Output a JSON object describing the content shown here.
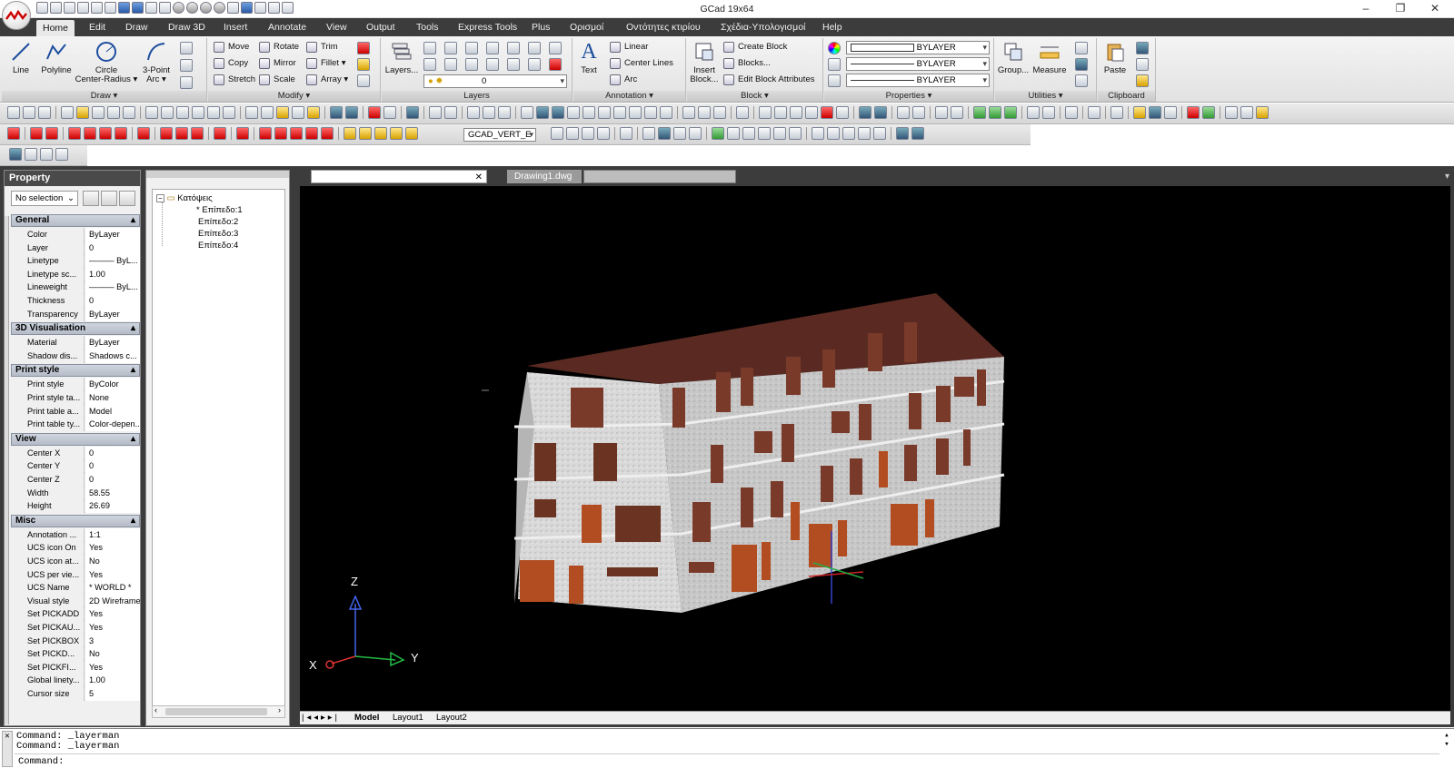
{
  "app": {
    "title": "GCad 19x64",
    "window_controls": [
      "minimize-icon",
      "restore-icon",
      "close-icon"
    ]
  },
  "menu": {
    "tabs": [
      "Home",
      "Edit",
      "Draw",
      "Draw 3D",
      "Insert",
      "Annotate",
      "View",
      "Output",
      "Tools",
      "Express Tools",
      "Plus",
      "Ορισμοί",
      "Οντότητες κτιρίου",
      "Σχέδια-Υπολογισμοί",
      "Help"
    ],
    "active": "Home"
  },
  "ribbon": {
    "draw": {
      "label": "Draw ▾",
      "line": "Line",
      "polyline": "Polyline",
      "circle1": "Circle",
      "circle2": "Center-Radius ▾",
      "arc1": "3-Point",
      "arc2": "Arc ▾"
    },
    "modify": {
      "label": "Modify ▾",
      "move": "Move",
      "rotate": "Rotate",
      "trim": "Trim",
      "copy": "Copy",
      "mirror": "Mirror",
      "fillet": "Fillet ▾",
      "stretch": "Stretch",
      "scale": "Scale",
      "array": "Array ▾"
    },
    "layers": {
      "label": "Layers",
      "button": "Layers...",
      "current_layer": "0"
    },
    "annotation": {
      "label": "Annotation ▾",
      "text": "Text",
      "linear": "Linear",
      "center_lines": "Center Lines",
      "arc": "Arc"
    },
    "block": {
      "label": "Block ▾",
      "insert1": "Insert",
      "insert2": "Block...",
      "create": "Create Block",
      "blocks": "Blocks...",
      "edit_attr": "Edit Block Attributes"
    },
    "properties": {
      "label": "Properties ▾",
      "color": "BYLAYER",
      "linetype": "BYLAYER",
      "lineweight": "BYLAYER"
    },
    "utilities": {
      "label": "Utilities ▾",
      "group": "Group...",
      "measure": "Measure"
    },
    "clipboard": {
      "label": "Clipboard",
      "paste": "Paste"
    }
  },
  "toolbar2": {
    "dimstyle": "GCAD_VERT_E"
  },
  "property_panel": {
    "title": "Property",
    "selection": "No selection",
    "sections": [
      {
        "name": "General",
        "rows": [
          [
            "Color",
            "ByLayer"
          ],
          [
            "Layer",
            "0"
          ],
          [
            "Linetype",
            "——— ByL..."
          ],
          [
            "Linetype sc...",
            "1.00"
          ],
          [
            "Lineweight",
            "——— ByL..."
          ],
          [
            "Thickness",
            "0"
          ],
          [
            "Transparency",
            "ByLayer"
          ]
        ]
      },
      {
        "name": "3D Visualisation",
        "rows": [
          [
            "Material",
            "ByLayer"
          ],
          [
            "Shadow dis...",
            "Shadows c..."
          ]
        ]
      },
      {
        "name": "Print style",
        "rows": [
          [
            "Print style",
            "ByColor"
          ],
          [
            "Print style ta...",
            "None"
          ],
          [
            "Print table a...",
            "Model"
          ],
          [
            "Print table ty...",
            "Color-depen..."
          ]
        ]
      },
      {
        "name": "View",
        "rows": [
          [
            "Center X",
            "0"
          ],
          [
            "Center Y",
            "0"
          ],
          [
            "Center Z",
            "0"
          ],
          [
            "Width",
            "58.55"
          ],
          [
            "Height",
            "26.69"
          ]
        ]
      },
      {
        "name": "Misc",
        "rows": [
          [
            "Annotation ...",
            "1:1"
          ],
          [
            "UCS icon On",
            "Yes"
          ],
          [
            "UCS icon at...",
            "No"
          ],
          [
            "UCS per vie...",
            "Yes"
          ],
          [
            "UCS Name",
            "* WORLD *"
          ],
          [
            "Visual style",
            "2D Wireframe"
          ],
          [
            "Set PICKADD",
            "Yes"
          ],
          [
            "Set PICKAU...",
            "Yes"
          ],
          [
            "Set PICKBOX",
            "3"
          ],
          [
            "Set PICKD...",
            "No"
          ],
          [
            "Set PICKFI...",
            "Yes"
          ],
          [
            "Global linety...",
            "1.00"
          ],
          [
            "Cursor size",
            "5"
          ]
        ]
      }
    ]
  },
  "tree": {
    "root": "Κατόψεις",
    "children": [
      "* Επίπεδο:1",
      "Επίπεδο:2",
      "Επίπεδο:3",
      "Επίπεδο:4"
    ]
  },
  "documents": {
    "active": "Drawing1.dwg"
  },
  "viewport": {
    "axis_x": "X",
    "axis_y": "Y",
    "axis_z": "Z"
  },
  "layouts": [
    "Model",
    "Layout1",
    "Layout2"
  ],
  "command": {
    "history": [
      "Command: _layerman",
      "Command: _layerman"
    ],
    "prompt": "Command:"
  }
}
